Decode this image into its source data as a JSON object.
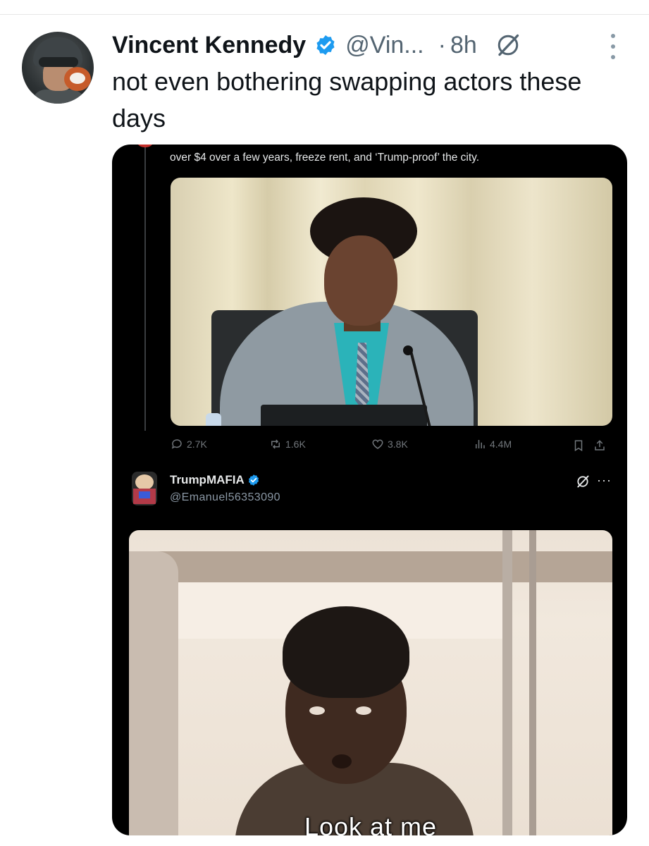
{
  "post": {
    "author": {
      "display_name": "Vincent Kennedy",
      "handle": "@Vin...",
      "verified": true
    },
    "time_separator": "·",
    "time": "8h",
    "text": "not even bothering swapping actors these days"
  },
  "embedded": {
    "quoted_text": "over $4 over a few years, freeze rent, and ‘Trump-proof’ the city.",
    "stats": {
      "replies": "2.7K",
      "reposts": "1.6K",
      "likes": "3.8K",
      "views": "4.4M"
    },
    "reply": {
      "display_name": "TrumpMAFIA",
      "handle": "@Emanuel56353090",
      "verified": true,
      "more": "···"
    },
    "gif_caption": "Look at me"
  },
  "colors": {
    "verified_blue": "#1d9bf0",
    "text_primary": "#0f1419",
    "text_secondary": "#536471"
  },
  "icons": [
    "verified-badge-icon",
    "grok-icon",
    "more-vertical-icon",
    "reply-icon",
    "repost-icon",
    "like-icon",
    "views-icon",
    "bookmark-icon",
    "share-icon"
  ]
}
